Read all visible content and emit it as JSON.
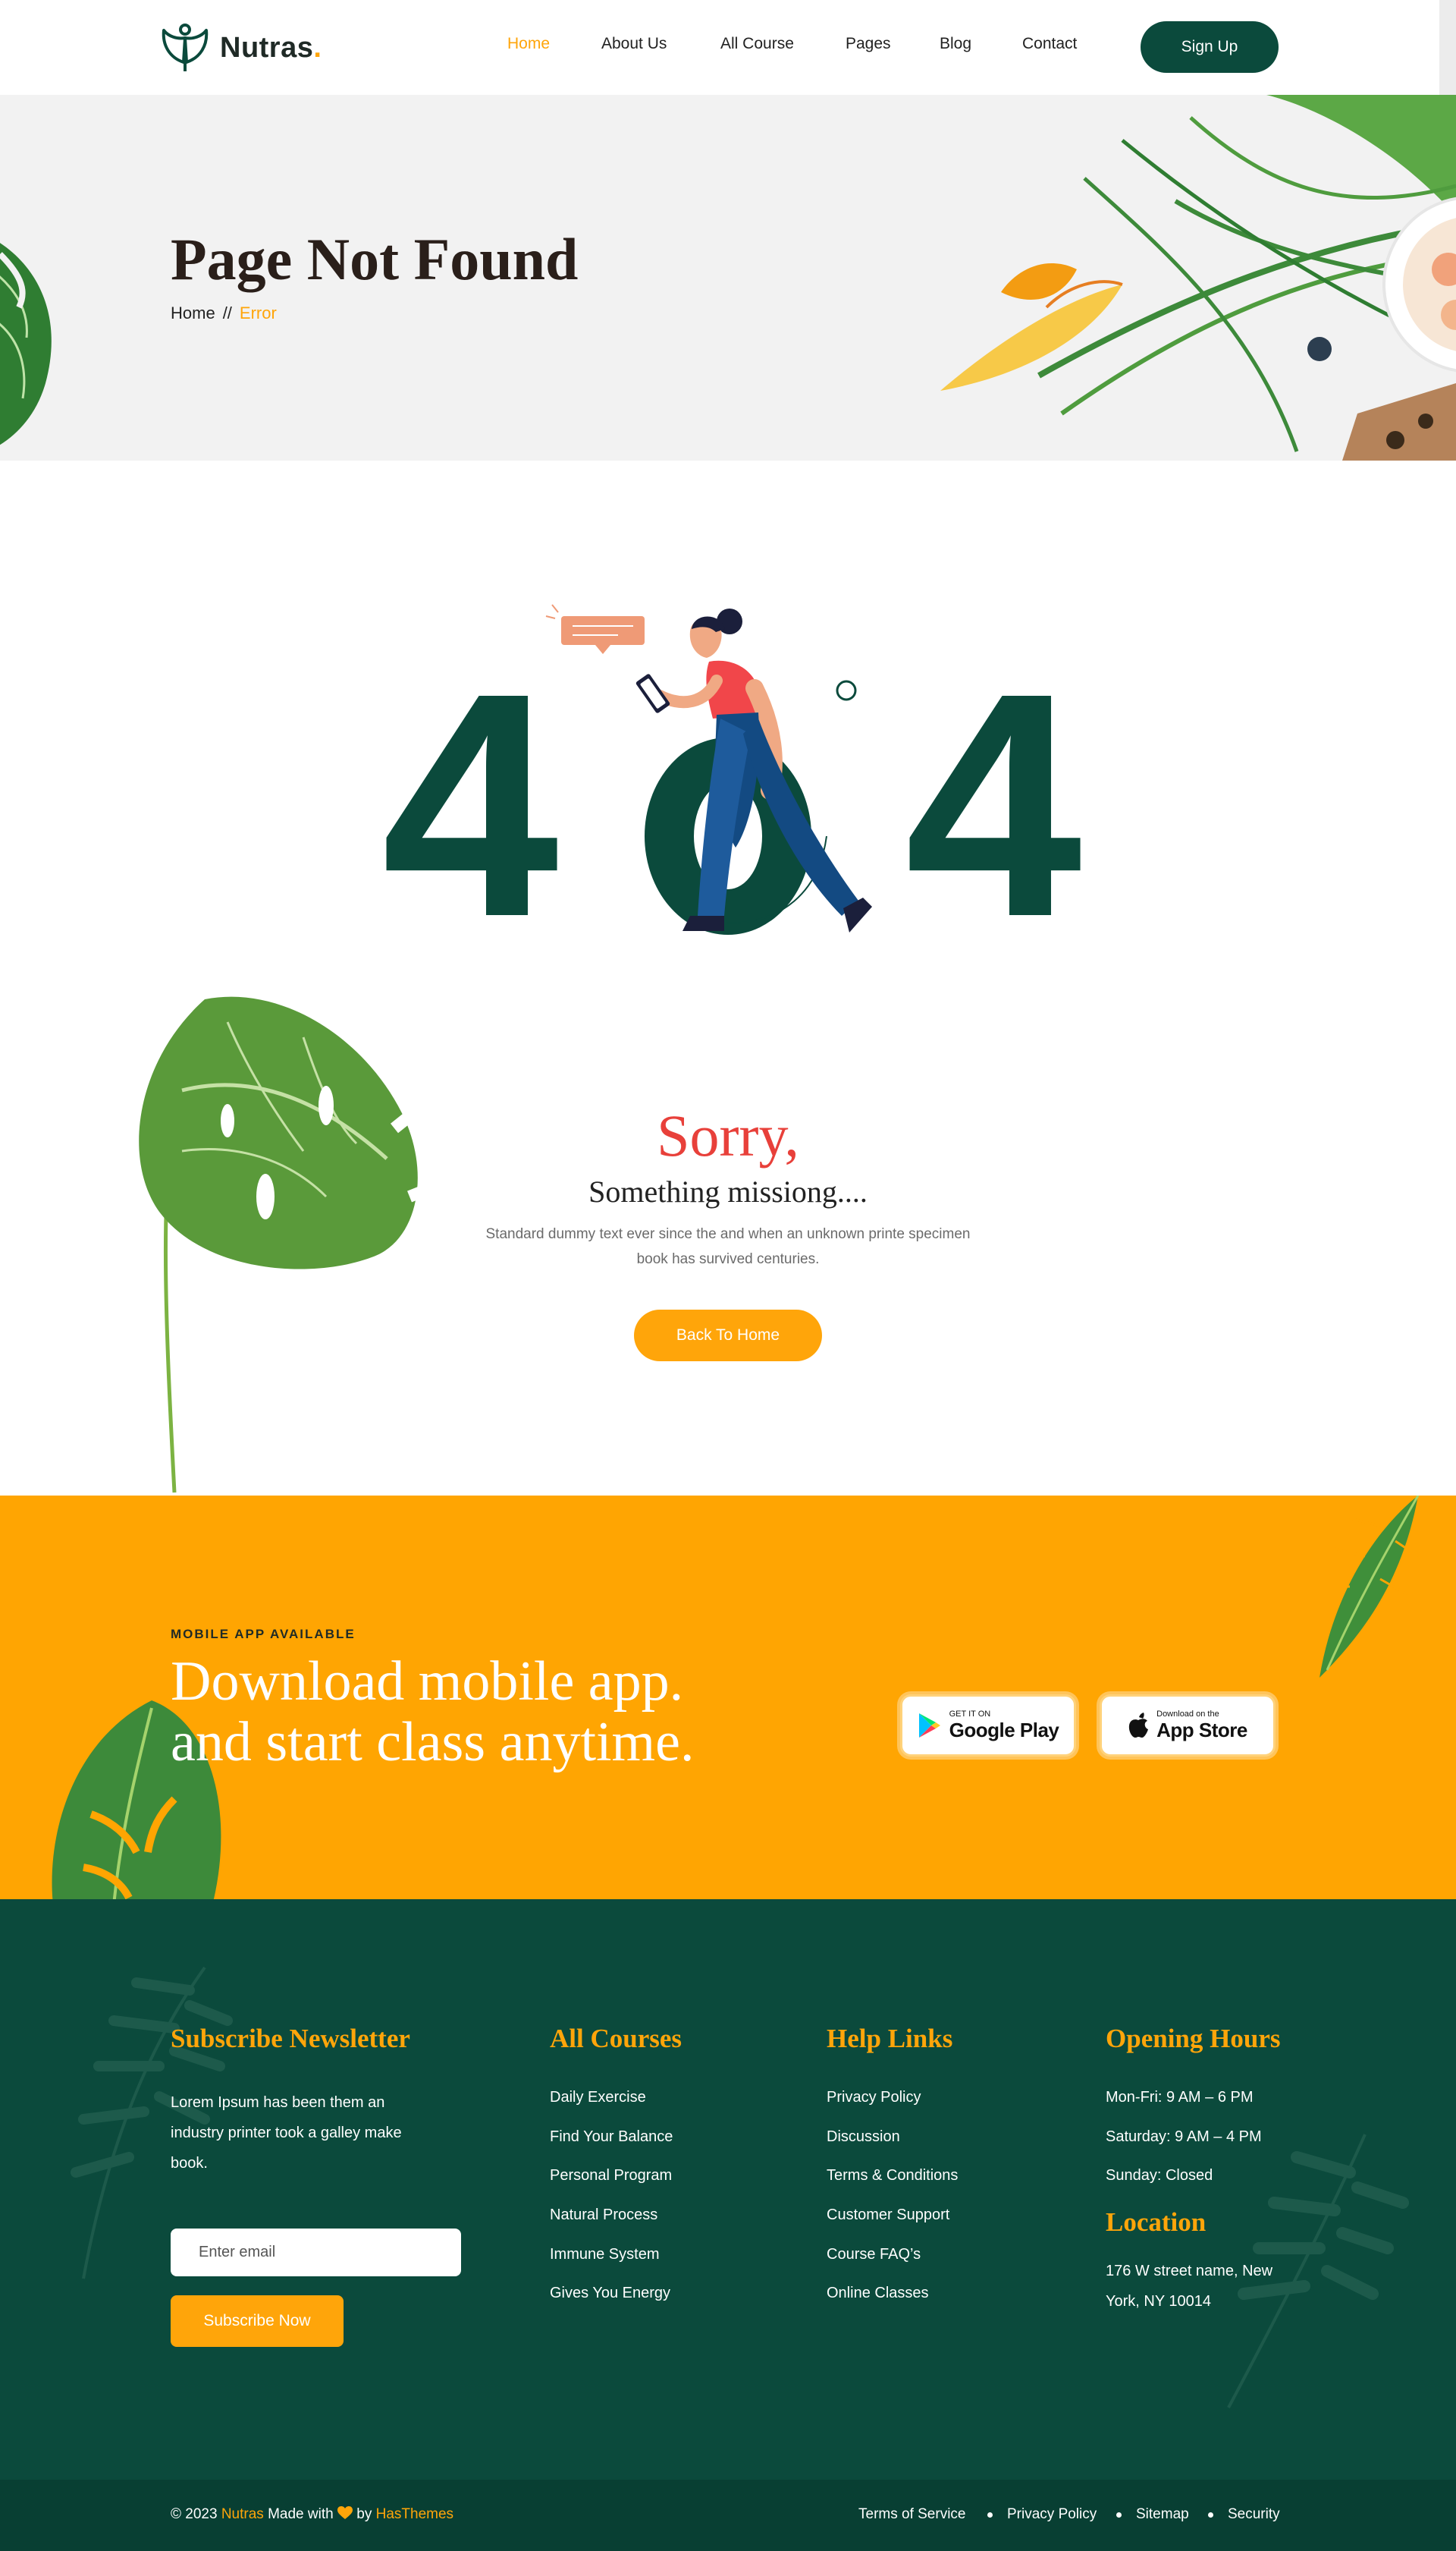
{
  "brand": {
    "name": "Nutras",
    "dot": ".",
    "primary": "#0b4a3c",
    "accent": "#ffa50a",
    "logo_icon": "leaf-person-icon"
  },
  "nav": {
    "items": [
      {
        "label": "Home",
        "active": true
      },
      {
        "label": "About Us",
        "active": false
      },
      {
        "label": "All Course",
        "active": false
      },
      {
        "label": "Pages",
        "active": false
      },
      {
        "label": "Blog",
        "active": false
      },
      {
        "label": "Contact",
        "active": false
      }
    ],
    "signup": "Sign Up"
  },
  "hero": {
    "title": "Page Not Found",
    "breadcrumb": {
      "home": "Home",
      "sep": "//",
      "current": "Error"
    }
  },
  "error": {
    "code_left": "4",
    "code_right": "4",
    "sorry": "Sorry,",
    "subtitle": "Something missiong....",
    "description": "Standard dummy text ever since the and when an unknown printe specimen book has survived centuries.",
    "button": "Back To Home"
  },
  "app": {
    "kicker": "MOBILE APP AVAILABLE",
    "title_line1": "Download mobile app.",
    "title_line2": "and start class anytime.",
    "google_small": "GET IT ON",
    "google_big": "Google Play",
    "apple_small": "Download on the",
    "apple_big": "App Store"
  },
  "footer": {
    "newsletter": {
      "title": "Subscribe Newsletter",
      "text_lines": [
        "Lorem Ipsum has been them an",
        "industry printer took a galley make",
        "book."
      ],
      "placeholder": "Enter email",
      "button": "Subscribe Now"
    },
    "courses": {
      "title": "All Courses",
      "links": [
        "Daily Exercise",
        "Find Your Balance",
        "Personal Program",
        "Natural Process",
        "Immune System",
        "Gives You Energy"
      ]
    },
    "help": {
      "title": "Help Links",
      "links": [
        "Privacy Policy",
        "Discussion",
        "Terms & Conditions",
        "Customer Support",
        "Course FAQ’s",
        "Online Classes"
      ]
    },
    "hours": {
      "title": "Opening Hours",
      "lines": [
        "Mon-Fri: 9 AM – 6 PM",
        "Saturday: 9 AM – 4 PM",
        "Sunday: Closed"
      ],
      "location_title": "Location",
      "address_lines": [
        "176 W street name, New",
        "York, NY 10014"
      ]
    }
  },
  "bottom": {
    "copy_prefix": "© 2023",
    "copy_brand": "Nutras",
    "copy_mid": "Made with",
    "copy_by": "by",
    "copy_author": "HasThemes",
    "legal": [
      "Terms of Service",
      "Privacy Policy",
      "Sitemap",
      "Security"
    ]
  }
}
